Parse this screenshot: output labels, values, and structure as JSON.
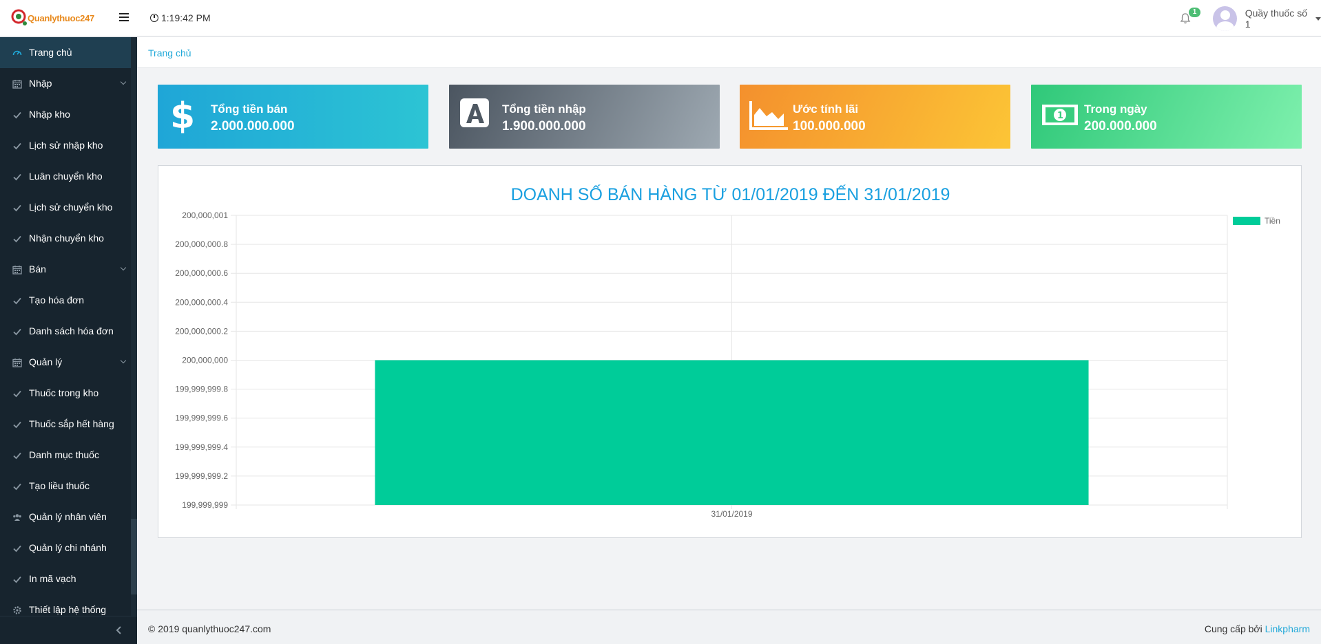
{
  "header": {
    "logo_text": "Quanlythuoc247",
    "time": "1:19:42 PM",
    "notification_count": "1",
    "user_name": "Quầy thuốc số 1"
  },
  "sidebar": {
    "items": [
      {
        "label": "Trang chủ",
        "icon": "dashboard-icon",
        "active": true
      },
      {
        "label": "Nhập",
        "icon": "calendar-icon",
        "dropdown": true
      },
      {
        "label": "Nhập kho",
        "icon": "check-icon"
      },
      {
        "label": "Lịch sử nhập kho",
        "icon": "check-icon"
      },
      {
        "label": "Luân chuyển kho",
        "icon": "check-icon"
      },
      {
        "label": "Lịch sử chuyển kho",
        "icon": "check-icon"
      },
      {
        "label": "Nhận chuyển kho",
        "icon": "check-icon"
      },
      {
        "label": "Bán",
        "icon": "calendar-icon",
        "dropdown": true
      },
      {
        "label": "Tạo hóa đơn",
        "icon": "check-icon"
      },
      {
        "label": "Danh sách hóa đơn",
        "icon": "check-icon"
      },
      {
        "label": "Quản lý",
        "icon": "calendar-icon",
        "dropdown": true
      },
      {
        "label": "Thuốc trong kho",
        "icon": "check-icon"
      },
      {
        "label": "Thuốc sắp hết hàng",
        "icon": "check-icon"
      },
      {
        "label": "Danh mục thuốc",
        "icon": "check-icon"
      },
      {
        "label": "Tạo liều thuốc",
        "icon": "check-icon"
      },
      {
        "label": "Quản lý nhân viên",
        "icon": "users-icon"
      },
      {
        "label": "Quản lý chi nhánh",
        "icon": "check-icon"
      },
      {
        "label": "In mã vạch",
        "icon": "check-icon"
      },
      {
        "label": "Thiết lập hệ thống",
        "icon": "gear-icon"
      }
    ]
  },
  "breadcrumb": {
    "current": "Trang chủ"
  },
  "cards": [
    {
      "title": "Tổng tiền bán",
      "value": "2.000.000.000",
      "icon": "dollar-icon"
    },
    {
      "title": "Tổng tiền nhập",
      "value": "1.900.000.000",
      "icon": "letter-a-icon"
    },
    {
      "title": "Ước tính lãi",
      "value": "100.000.000",
      "icon": "area-chart-icon"
    },
    {
      "title": "Trong ngày",
      "value": "200.000.000",
      "icon": "money-icon"
    }
  ],
  "chart_data": {
    "type": "bar",
    "title": "DOANH SỐ BÁN HÀNG TỪ 01/01/2019 ĐẾN 31/01/2019",
    "categories": [
      "31/01/2019"
    ],
    "series": [
      {
        "name": "Tiền",
        "values": [
          200000000
        ],
        "color": "#00cc99"
      }
    ],
    "ylim": [
      199999999,
      200000001
    ],
    "yticks": [
      "200,000,001",
      "200,000,000.8",
      "200,000,000.6",
      "200,000,000.4",
      "200,000,000.2",
      "200,000,000",
      "199,999,999.8",
      "199,999,999.6",
      "199,999,999.4",
      "199,999,999.2",
      "199,999,999"
    ],
    "grid": true,
    "legend": "top-right"
  },
  "footer": {
    "copyright": "© 2019 quanlythuoc247.com",
    "credit_prefix": "Cung cấp bởi",
    "credit_link": "Linkpharm"
  }
}
